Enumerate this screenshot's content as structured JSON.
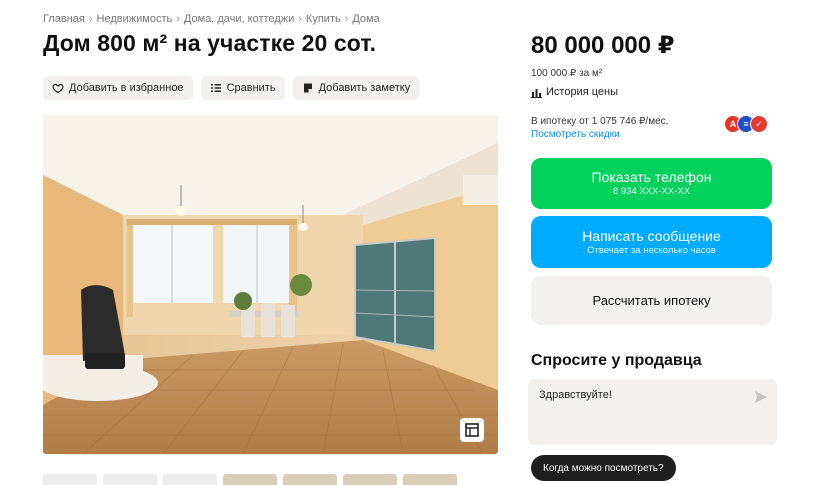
{
  "breadcrumb": [
    "Главная",
    "Недвижимость",
    "Дома, дачи, коттеджи",
    "Купить",
    "Дома"
  ],
  "title": "Дом 800 м² на участке 20 сот.",
  "actions": {
    "favorite": "Добавить в избранное",
    "compare": "Сравнить",
    "note": "Добавить заметку"
  },
  "price": {
    "total": "80 000 000 ₽",
    "per_sqm": "100 000 ₽ за м²",
    "history": "История цены"
  },
  "mortgage": {
    "text": "В ипотеку от 1 075 746 ₽/мес.",
    "link": "Посмотреть скидки",
    "banks": [
      {
        "letter": "А",
        "color": "#ef3124"
      },
      {
        "letter": "≡",
        "color": "#1f4fc7"
      },
      {
        "letter": "✓",
        "color": "#e53935"
      }
    ]
  },
  "buttons": {
    "phone": "Показать телефон",
    "phone_number": "8 934 XXX-XX-XX",
    "message": "Написать сообщение",
    "message_sub": "Отвечает за несколько часов",
    "calc": "Рассчитать ипотеку"
  },
  "ask": {
    "title": "Спросите у продавца",
    "message": "Здравствуйте!",
    "chip": "Когда можно посмотреть?"
  },
  "colors": {
    "green": "#02d15c",
    "blue": "#00aaff",
    "link": "#0a8cf0",
    "light_bg": "#f2f1f0"
  },
  "icons": {
    "favorite": "heart-icon",
    "compare": "compare-icon",
    "note": "note-icon",
    "history": "chart-icon",
    "expand": "expand-icon",
    "send": "send-icon"
  }
}
